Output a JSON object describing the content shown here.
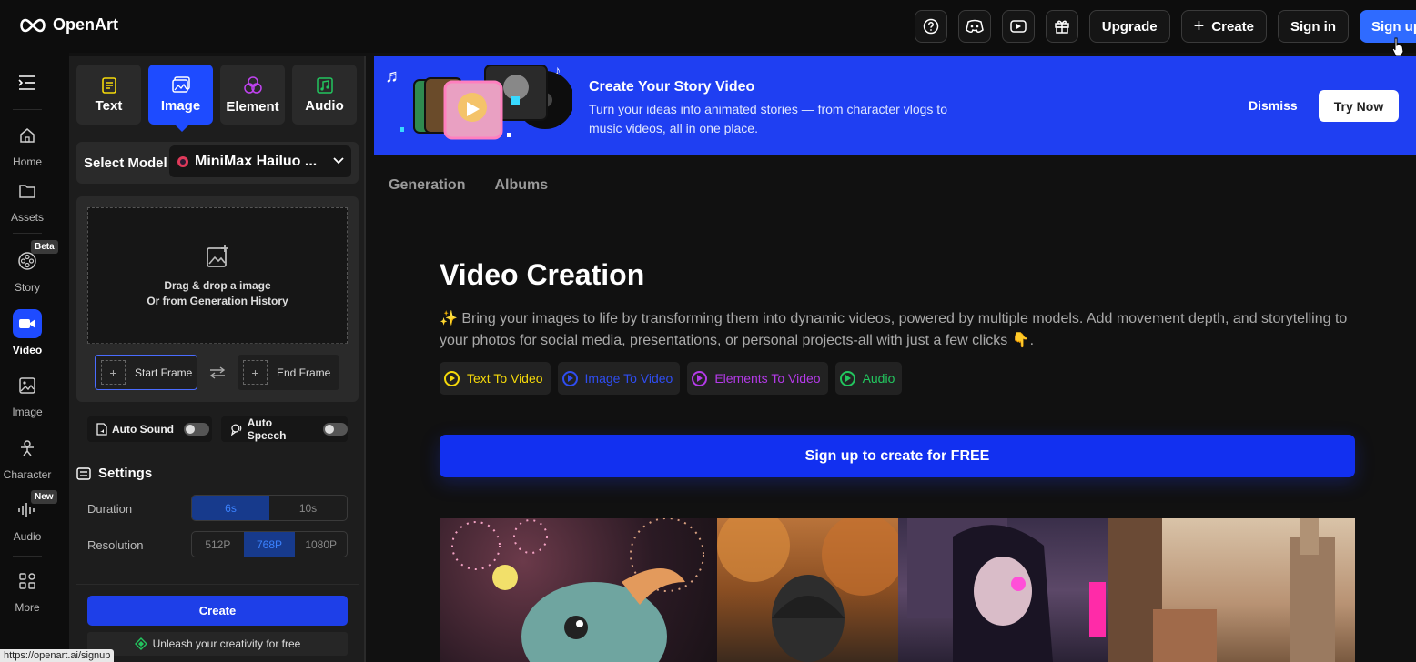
{
  "header": {
    "brand": "OpenArt",
    "upgrade_label": "Upgrade",
    "create_label": "Create",
    "signin_label": "Sign in",
    "signup_label": "Sign up"
  },
  "nav": {
    "items": [
      {
        "label": "Home"
      },
      {
        "label": "Assets"
      },
      {
        "label": "Story",
        "badge": "Beta"
      },
      {
        "label": "Video"
      },
      {
        "label": "Image"
      },
      {
        "label": "Character"
      },
      {
        "label": "Audio",
        "badge": "New"
      },
      {
        "label": "More"
      }
    ]
  },
  "panel": {
    "tabs": [
      {
        "label": "Text",
        "color": "#f5d90a"
      },
      {
        "label": "Image",
        "color": "#ffffff"
      },
      {
        "label": "Element",
        "color": "#c043f0"
      },
      {
        "label": "Audio",
        "color": "#22c55e"
      }
    ],
    "select_model_label": "Select Model",
    "model_value": "MiniMax Hailuo ...",
    "drop_line1": "Drag & drop a image",
    "drop_line2": "Or from Generation History",
    "start_frame": "Start Frame",
    "end_frame": "End Frame",
    "auto_sound": "Auto Sound",
    "auto_speech": "Auto Speech",
    "settings_label": "Settings",
    "duration_label": "Duration",
    "duration_options": [
      "6s",
      "10s"
    ],
    "resolution_label": "Resolution",
    "resolution_options": [
      "512P",
      "768P",
      "1080P"
    ],
    "create_label": "Create",
    "unleash_label": "Unleash your creativity for free"
  },
  "banner": {
    "title": "Create Your Story Video",
    "subtitle": "Turn your ideas into animated stories — from character vlogs to music videos, all in one place.",
    "dismiss": "Dismiss",
    "try_now": "Try Now"
  },
  "main": {
    "tabs": [
      "Generation",
      "Albums"
    ],
    "title": "Video Creation",
    "description": "✨ Bring your images to life by transforming them into dynamic videos, powered by multiple models. Add movement depth, and storytelling to your photos for social media, presentations, or personal projects-all with just a few clicks 👇.",
    "chips": [
      {
        "label": "Text To Video",
        "color": "#f5d90a"
      },
      {
        "label": "Image To Video",
        "color": "#2f4df0"
      },
      {
        "label": "Elements To Video",
        "color": "#b43ae8"
      },
      {
        "label": "Audio",
        "color": "#22c55e"
      }
    ],
    "cta": "Sign up to create for FREE"
  },
  "status_url": "https://openart.ai/signup",
  "colors": {
    "accent": "#1e4bff",
    "banner": "#1f3ff2"
  }
}
